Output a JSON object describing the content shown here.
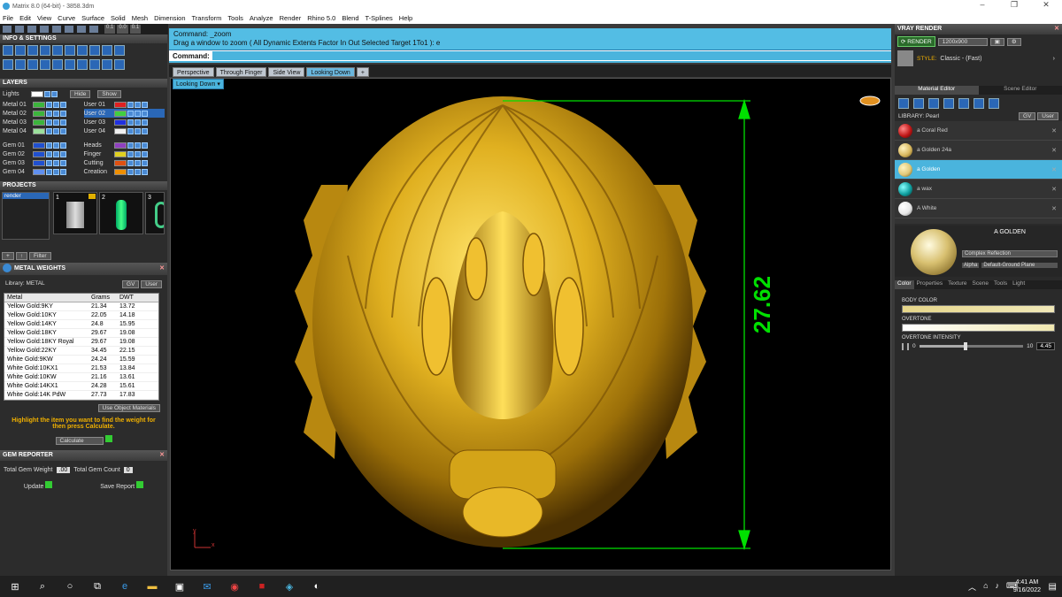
{
  "window": {
    "title": "Matrix 8.0 (64-bit) - 3858.3dm",
    "min": "–",
    "max": "❐",
    "close": "✕"
  },
  "menu": [
    "File",
    "Edit",
    "View",
    "Curve",
    "Surface",
    "Solid",
    "Mesh",
    "Dimension",
    "Transform",
    "Tools",
    "Analyze",
    "Render",
    "Rhino 5.0",
    "Blend",
    "T-Splines",
    "Help"
  ],
  "toolstrip": {
    "field1": "0.1",
    "field2": "0.0",
    "field3": "0.1"
  },
  "info_settings": {
    "title": "INFO & SETTINGS"
  },
  "layers": {
    "title": "LAYERS",
    "lights": "Lights",
    "hide": "Hide",
    "show": "Show",
    "left": [
      {
        "name": "Metal 01",
        "color": "#3cb43c"
      },
      {
        "name": "Metal 02",
        "color": "#3cb43c"
      },
      {
        "name": "Metal 03",
        "color": "#3cb43c"
      },
      {
        "name": "Metal 04",
        "color": "#9ce09c"
      },
      {
        "name": "Gem 01",
        "color": "#2050d0"
      },
      {
        "name": "Gem 02",
        "color": "#2050d0"
      },
      {
        "name": "Gem 03",
        "color": "#2050d0"
      },
      {
        "name": "Gem 04",
        "color": "#6090f0"
      }
    ],
    "right": [
      {
        "name": "User 01",
        "color": "#e02020"
      },
      {
        "name": "User 02",
        "color": "#40d040"
      },
      {
        "name": "User 03",
        "color": "#2030e0"
      },
      {
        "name": "User 04",
        "color": "#f0f0f0"
      },
      {
        "name": "Heads",
        "color": "#9040c0"
      },
      {
        "name": "Finger",
        "color": "#e0d020"
      },
      {
        "name": "Cutting",
        "color": "#e05010"
      },
      {
        "name": "Creation",
        "color": "#f09000"
      }
    ]
  },
  "projects": {
    "title": "PROJECTS",
    "item": "render",
    "thumbs": [
      "1",
      "2",
      "3"
    ],
    "filter": "Filter"
  },
  "metal_weights": {
    "title": "METAL WEIGHTS",
    "library": "Library: METAL",
    "gv": "GV",
    "user": "User",
    "headers": [
      "Metal",
      "Grams",
      "DWT"
    ],
    "rows": [
      [
        "Yellow Gold:9KY",
        "21.34",
        "13.72"
      ],
      [
        "Yellow Gold:10KY",
        "22.05",
        "14.18"
      ],
      [
        "Yellow Gold:14KY",
        "24.8",
        "15.95"
      ],
      [
        "Yellow Gold:18KY",
        "29.67",
        "19.08"
      ],
      [
        "Yellow Gold:18KY Royal",
        "29.67",
        "19.08"
      ],
      [
        "Yellow Gold:22KY",
        "34.45",
        "22.15"
      ],
      [
        "White Gold:9KW",
        "24.24",
        "15.59"
      ],
      [
        "White Gold:10KX1",
        "21.53",
        "13.84"
      ],
      [
        "White Gold:10KW",
        "21.16",
        "13.61"
      ],
      [
        "White Gold:14KX1",
        "24.28",
        "15.61"
      ],
      [
        "White Gold:14K PdW",
        "27.73",
        "17.83"
      ]
    ],
    "use_object": "Use Object Materials",
    "hint": "Highlight the item you want to find the weight for then press Calculate.",
    "calculate": "Calculate"
  },
  "gem_reporter": {
    "title": "GEM REPORTER",
    "total_weight_label": "Total Gem Weight",
    "total_weight": ".00",
    "total_count_label": "Total Gem Count",
    "total_count": "0",
    "update": "Update",
    "save_report": "Save Report"
  },
  "command": {
    "line1": "Command: _zoom",
    "line2": "Drag a window to zoom ( All  Dynamic  Extents  Factor  In  Out  Selected  Target  1To1 ): e",
    "label": "Command:"
  },
  "viewtabs": [
    "Perspective",
    "Through Finger",
    "Side View",
    "Looking Down",
    "+"
  ],
  "active_view": "Looking Down",
  "dimension": "27.62",
  "axis": {
    "y": "y",
    "x": "x"
  },
  "vray": {
    "title": "VRAY RENDER",
    "render": "RENDER",
    "resolution": "1200x900",
    "style_label": "STYLE:",
    "style": "Classic - (Fast)",
    "tabs": [
      "Material Editor",
      "Scene Editor"
    ],
    "library": "LIBRARY: Pearl",
    "gv": "GV",
    "user": "User",
    "materials": [
      {
        "name": "a Coral Red",
        "color": "#c01818"
      },
      {
        "name": "a Golden 24a",
        "color": "#d8b860"
      },
      {
        "name": "a Golden",
        "color": "#e0c878"
      },
      {
        "name": "a wax",
        "color": "#10a0a0"
      },
      {
        "name": "A White",
        "color": "#e8e8e8"
      }
    ],
    "selected": "A GOLDEN",
    "reflection": "Complex Reflection",
    "alpha": "Alpha",
    "ground": "Default-Ground Plane",
    "prop_tabs": [
      "Color",
      "Properties",
      "Texture",
      "Scene",
      "Tools",
      "Light"
    ],
    "body_color": "BODY COLOR",
    "overtone": "OVERTONE",
    "overtone_intensity": "OVERTONE INTENSITY",
    "intensity_min": "0",
    "intensity_max": "10",
    "intensity_value": "4.45",
    "intensity_fraction": 0.445
  },
  "taskbar": {
    "time": "4:41 AM",
    "date": "9/16/2022"
  },
  "colors": {
    "accent": "#4ab4dd",
    "gold": "#d4a820",
    "dim": "#00e000"
  }
}
